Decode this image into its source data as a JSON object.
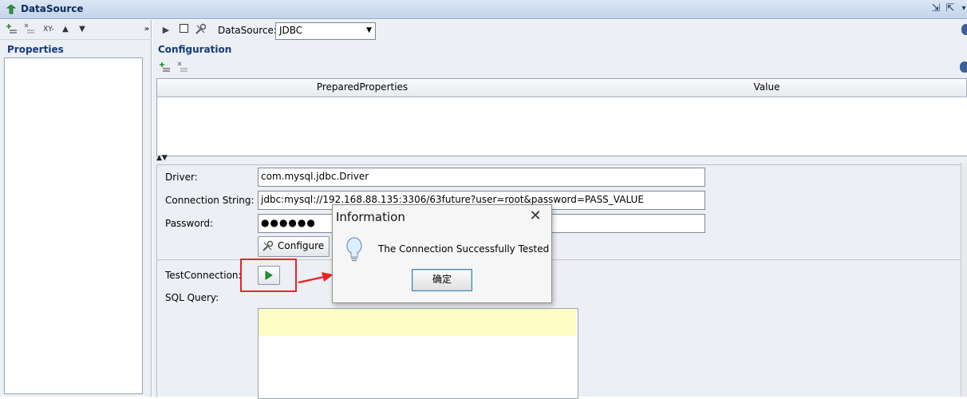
{
  "window": {
    "title": "DataSource",
    "restore_icon": "restore-down-icon",
    "maximize_icon": "maximize-icon"
  },
  "left_panel": {
    "toolbar": [
      "add-row-icon",
      "delete-row-icon",
      "xy-icon",
      "move-up-icon",
      "move-down-icon"
    ],
    "xy_text": "XY-",
    "heading": "Properties"
  },
  "datasource": {
    "label": "DataSource:",
    "selected": "JDBC",
    "toolbar_icons": [
      "run-icon",
      "stop-icon",
      "tools-icon"
    ]
  },
  "configuration": {
    "heading": "Configuration",
    "table": {
      "columns": [
        "PreparedProperties",
        "Value"
      ],
      "rows": []
    }
  },
  "form": {
    "driver_label": "Driver:",
    "driver_value": "com.mysql.jdbc.Driver",
    "conn_label": "Connection String:",
    "conn_value": "jdbc:mysql://192.168.88.135:3306/63future?user=root&password=PASS_VALUE",
    "password_label": "Password:",
    "password_value": "●●●●●●",
    "configure_label": "Configure",
    "test_label": "TestConnection:",
    "sql_label": "SQL Query:",
    "sql_value": ""
  },
  "dialog": {
    "title": "Information",
    "message": "The Connection Successfully Tested",
    "ok_label": "确定",
    "icon": "lightbulb-icon"
  },
  "colors": {
    "accent": "#153a7a",
    "annotation": "#e8262a",
    "highlight": "#fdfcc4"
  }
}
